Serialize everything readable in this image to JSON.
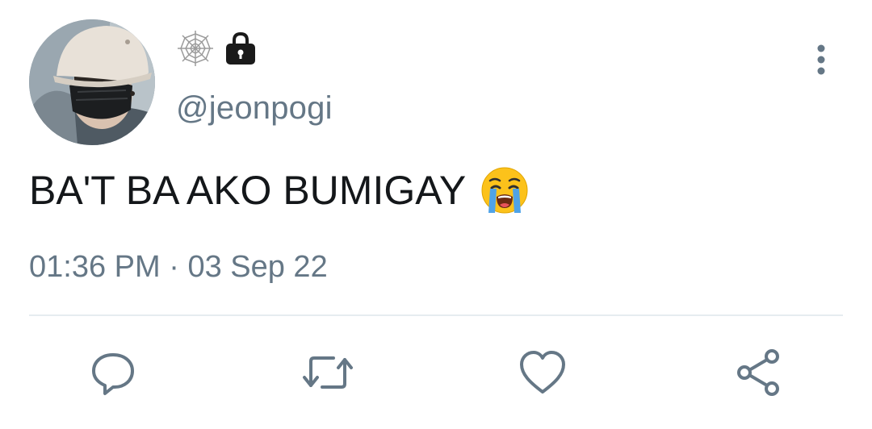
{
  "tweet": {
    "handle": "@jeonpogi",
    "text": "BA'T BA AKO BUMIGAY",
    "text_emoji": "loudly-crying-face",
    "time": "01:36 PM",
    "separator": " · ",
    "date": "03 Sep 22"
  },
  "icons": {
    "profile_badges": [
      "spider-web-icon",
      "lock-icon"
    ],
    "menu": "more-vertical-icon",
    "actions": [
      "reply-icon",
      "retweet-icon",
      "like-icon",
      "share-icon"
    ]
  },
  "colors": {
    "text": "#14171a",
    "secondary": "#657786",
    "divider": "#e6ecf0",
    "action_icon": "#657786"
  }
}
